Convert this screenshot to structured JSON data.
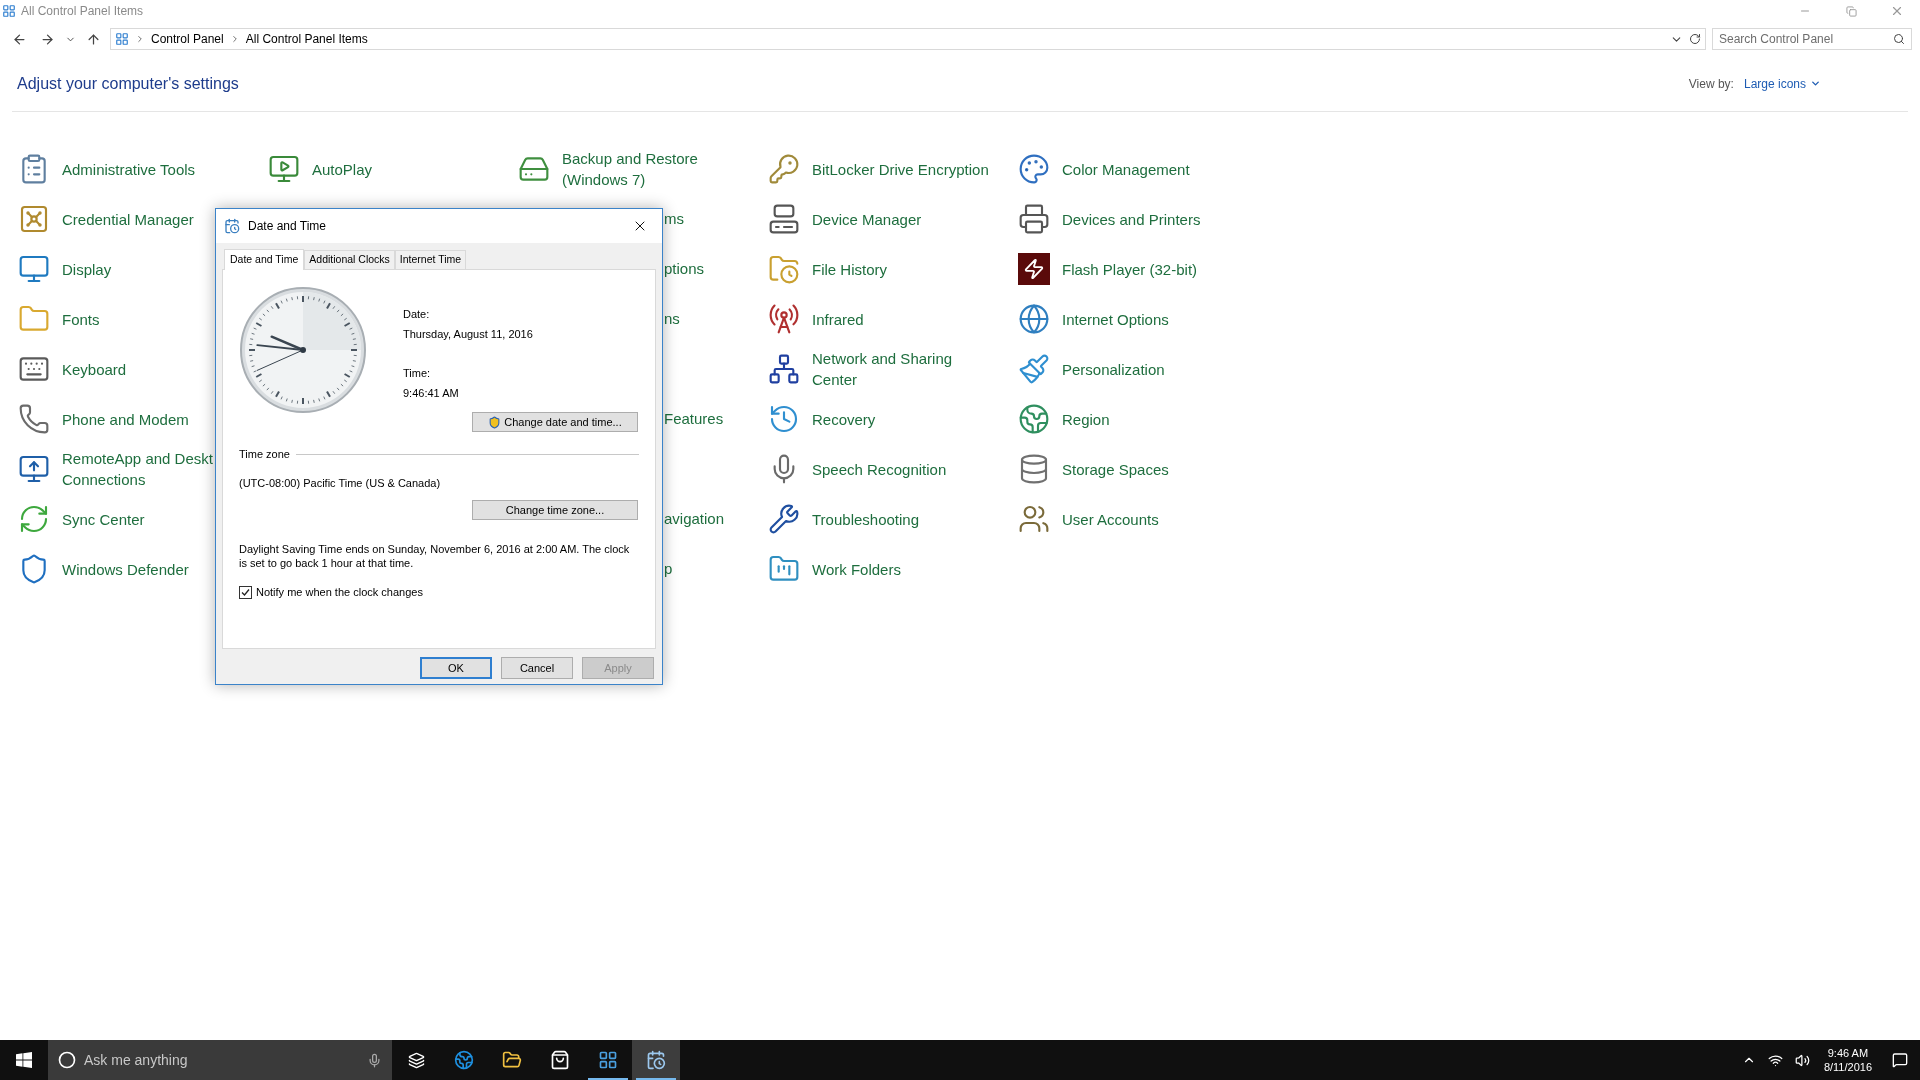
{
  "window": {
    "title": "All Control Panel Items"
  },
  "address_bar": {
    "breadcrumbs": [
      "Control Panel",
      "All Control Panel Items"
    ],
    "search_placeholder": "Search Control Panel"
  },
  "header": {
    "title": "Adjust your computer's settings",
    "view_by_label": "View by:",
    "view_by_value": "Large icons"
  },
  "columns": [
    {
      "items": [
        {
          "label": "Administrative Tools"
        },
        {
          "label": "Credential Manager"
        },
        {
          "label": "Display"
        },
        {
          "label": "Fonts"
        },
        {
          "label": "Keyboard"
        },
        {
          "label": "Phone and Modem"
        },
        {
          "label": "RemoteApp and Deskt\nConnections"
        },
        {
          "label": "Sync Center"
        },
        {
          "label": "Windows Defender"
        }
      ]
    },
    {
      "items": [
        {
          "label": "AutoPlay"
        }
      ]
    },
    {
      "items": [
        {
          "label": "Backup and Restore\n(Windows 7)"
        },
        {
          "label": "ms",
          "kind": "cut"
        },
        {
          "label": "ptions",
          "kind": "cut"
        },
        {
          "label": "ns",
          "kind": "cut"
        },
        {
          "kind": "covered"
        },
        {
          "label": "Features",
          "kind": "cut"
        },
        {
          "kind": "covered"
        },
        {
          "label": "avigation",
          "kind": "cut"
        },
        {
          "label": "p",
          "kind": "cut"
        }
      ]
    },
    {
      "items": [
        {
          "label": "BitLocker Drive Encryption"
        },
        {
          "label": "Device Manager"
        },
        {
          "label": "File History"
        },
        {
          "label": "Infrared"
        },
        {
          "label": "Network and Sharing\nCenter"
        },
        {
          "label": "Recovery"
        },
        {
          "label": "Speech Recognition"
        },
        {
          "label": "Troubleshooting"
        },
        {
          "label": "Work Folders"
        }
      ]
    },
    {
      "items": [
        {
          "label": "Color Management"
        },
        {
          "label": "Devices and Printers"
        },
        {
          "label": "Flash Player (32-bit)"
        },
        {
          "label": "Internet Options"
        },
        {
          "label": "Personalization"
        },
        {
          "label": "Region"
        },
        {
          "label": "Storage Spaces"
        },
        {
          "label": "User Accounts"
        }
      ]
    }
  ],
  "dialog": {
    "title": "Date and Time",
    "tabs": [
      {
        "label": "Date and Time",
        "selected": true
      },
      {
        "label": "Additional Clocks",
        "selected": false
      },
      {
        "label": "Internet Time",
        "selected": false
      }
    ],
    "date_label": "Date:",
    "date_value": "Thursday, August 11, 2016",
    "time_label": "Time:",
    "time_value": "9:46:41 AM",
    "change_datetime_button": "Change date and time...",
    "timezone_heading": "Time zone",
    "timezone_value": "(UTC-08:00) Pacific Time (US & Canada)",
    "change_timezone_button": "Change time zone...",
    "dst_note": "Daylight Saving Time ends on Sunday, November 6, 2016 at 2:00 AM. The clock is set to go back 1 hour at that time.",
    "notify": {
      "label": "Notify me when the clock changes",
      "checked": true
    },
    "buttons": [
      {
        "label": "OK",
        "default": true,
        "disabled": false
      },
      {
        "label": "Cancel",
        "default": false,
        "disabled": false
      },
      {
        "label": "Apply",
        "default": false,
        "disabled": true
      }
    ]
  },
  "taskbar": {
    "search_placeholder": "Ask me anything",
    "apps": [
      {
        "running": false,
        "active": false
      },
      {
        "running": false,
        "active": false
      },
      {
        "running": false,
        "active": false
      },
      {
        "running": true,
        "active": false
      },
      {
        "running": true,
        "active": true
      }
    ],
    "time": "9:46 AM",
    "date": "8/11/2016"
  }
}
